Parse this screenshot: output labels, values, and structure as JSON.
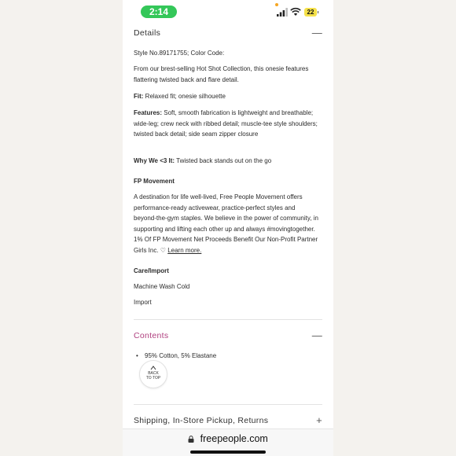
{
  "status_bar": {
    "time": "2:14",
    "battery": "22",
    "icons": [
      "signal-icon",
      "wifi-icon",
      "battery-icon"
    ]
  },
  "details": {
    "title": "Details",
    "toggle": "—",
    "style_line": "Style No.89171755; Color Code:",
    "description": "From our brest-selling Hot Shot Collection, this onesie features flattering twisted back and flare detail.",
    "fit_label": "Fit:",
    "fit_value": "Relaxed fit; onesie silhouette",
    "features_label": "Features:",
    "features_value": "Soft, smooth fabrication is lightweight and breathable; wide-leg; crew neck with ribbed detail; muscle-tee style shoulders; twisted back detail; side seam zipper closure",
    "why_label": "Why We <3 It:",
    "why_value": "Twisted back stands out on the go",
    "fp_title": "FP Movement",
    "fp_text": "A destination for life well-lived, Free People Movement offers performance-ready activewear, practice-perfect styles and beyond-the-gym staples. We believe in the power of community, in supporting and lifting each other up and always #movingtogether. 1% Of FP Movement Net Proceeds Benefit Our Non-Profit Partner Girls Inc. ♡",
    "learn_more": "Learn more.",
    "care_title": "Care/Import",
    "care_wash": "Machine Wash Cold",
    "care_import": "Import"
  },
  "contents": {
    "title": "Contents",
    "toggle": "—",
    "items": [
      "95% Cotton, 5% Elastane"
    ]
  },
  "back_to_top": {
    "line1": "BACK",
    "line2": "TO TOP"
  },
  "shipping": {
    "title": "Shipping, In-Store Pickup, Returns",
    "toggle": "+"
  },
  "browser": {
    "url": "freepeople.com"
  },
  "colors": {
    "accent": "#b0407f",
    "status_green": "#34c759",
    "battery_yellow": "#f5e14a"
  }
}
